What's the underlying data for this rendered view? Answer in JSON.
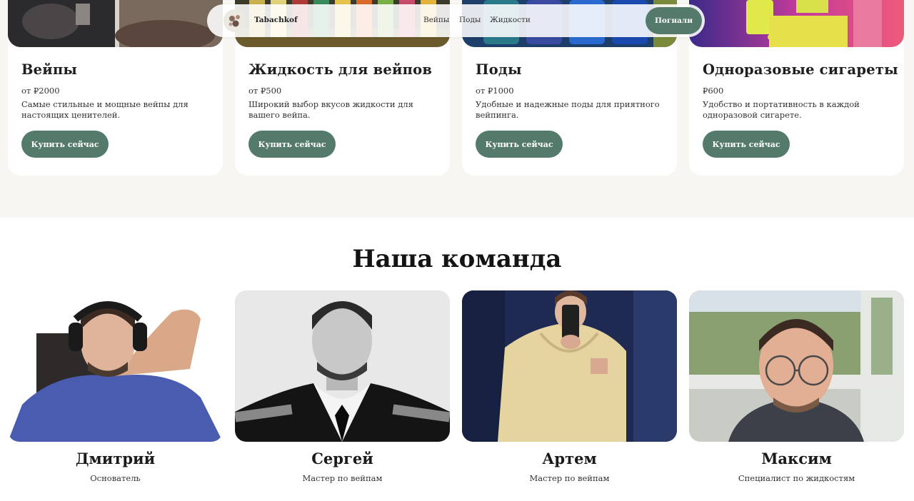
{
  "header": {
    "brand": "Tabachkof",
    "nav": [
      "Вейпы",
      "Поды",
      "Жидкости"
    ],
    "cta_label": "Погнали"
  },
  "products": [
    {
      "title": "Вейпы",
      "price": "от ₽2000",
      "description": "Самые стильные и мощные вейпы для настоящих ценителей.",
      "button": "Купить сейчас"
    },
    {
      "title": "Жидкость для вейпов",
      "price": "от ₽500",
      "description": "Широкий выбор вкусов жидкости для вашего вейпа.",
      "button": "Купить сейчас"
    },
    {
      "title": "Поды",
      "price": "от ₽1000",
      "description": "Удобные и надежные поды для приятного вейпинга.",
      "button": "Купить сейчас"
    },
    {
      "title": "Одноразовые сигареты",
      "price": "₽600",
      "description": "Удобство и портативность в каждой одноразовой сигарете.",
      "button": "Купить сейчас"
    }
  ],
  "team": {
    "title": "Наша команда",
    "members": [
      {
        "name": "Дмитрий",
        "role": "Основатель"
      },
      {
        "name": "Сергей",
        "role": "Мастер по вейпам"
      },
      {
        "name": "Артем",
        "role": "Мастер по вейпам"
      },
      {
        "name": "Максим",
        "role": "Специалист по жидкостям"
      }
    ]
  },
  "colors": {
    "accent": "#537a6b",
    "section_bg": "#f7f6f2",
    "card_bg": "#ffffff"
  }
}
